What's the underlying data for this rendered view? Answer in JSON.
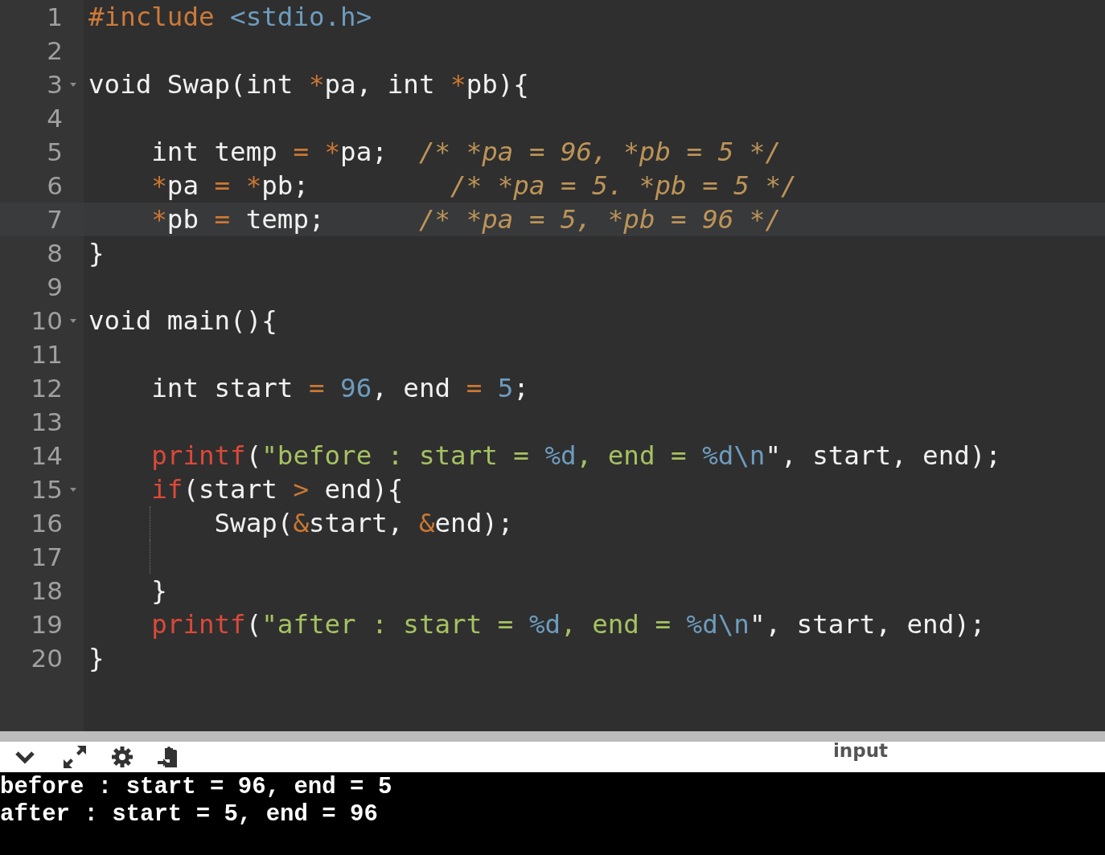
{
  "editor": {
    "lines": [
      {
        "number": "1",
        "fold": false,
        "active": false,
        "indent_guide": false,
        "tokens": [
          {
            "kind": "pre",
            "text": "#include "
          },
          {
            "kind": "header",
            "text": "<stdio.h>"
          }
        ]
      },
      {
        "number": "2",
        "fold": false,
        "active": false,
        "indent_guide": false
      },
      {
        "number": "3",
        "fold": true,
        "active": false,
        "indent_guide": false,
        "tokens": [
          {
            "kind": "plain",
            "text": "void Swap(int "
          },
          {
            "kind": "op",
            "text": "*"
          },
          {
            "kind": "plain",
            "text": "pa, int "
          },
          {
            "kind": "op",
            "text": "*"
          },
          {
            "kind": "plain",
            "text": "pb){"
          }
        ]
      },
      {
        "number": "4",
        "fold": false,
        "active": false,
        "indent_guide": false
      },
      {
        "number": "5",
        "fold": false,
        "active": false,
        "indent_guide": false,
        "tokens": [
          {
            "kind": "plain",
            "text": "    int temp "
          },
          {
            "kind": "op",
            "text": "= *"
          },
          {
            "kind": "plain",
            "text": "pa;  "
          },
          {
            "kind": "cmt",
            "text": "/* *pa = 96, *pb = 5 */"
          }
        ]
      },
      {
        "number": "6",
        "fold": false,
        "active": false,
        "indent_guide": false,
        "tokens": [
          {
            "kind": "op",
            "text": "    *"
          },
          {
            "kind": "plain",
            "text": "pa "
          },
          {
            "kind": "op",
            "text": "= *"
          },
          {
            "kind": "plain",
            "text": "pb;"
          },
          {
            "kind": "cmt",
            "text": "         /* *pa = 5. *pb = 5 */"
          }
        ]
      },
      {
        "number": "7",
        "fold": false,
        "active": true,
        "indent_guide": false,
        "tokens": [
          {
            "kind": "op",
            "text": "    *"
          },
          {
            "kind": "plain",
            "text": "pb "
          },
          {
            "kind": "op",
            "text": "="
          },
          {
            "kind": "plain",
            "text": " temp;      "
          },
          {
            "kind": "cmt",
            "text": "/* *pa = 5, *pb = 96 */"
          }
        ]
      },
      {
        "number": "8",
        "fold": false,
        "active": false,
        "indent_guide": false,
        "tokens": [
          {
            "kind": "plain",
            "text": "}"
          }
        ]
      },
      {
        "number": "9",
        "fold": false,
        "active": false,
        "indent_guide": false
      },
      {
        "number": "10",
        "fold": true,
        "active": false,
        "indent_guide": false,
        "tokens": [
          {
            "kind": "plain",
            "text": "void main(){"
          }
        ]
      },
      {
        "number": "11",
        "fold": false,
        "active": false,
        "indent_guide": false
      },
      {
        "number": "12",
        "fold": false,
        "active": false,
        "indent_guide": false,
        "tokens": [
          {
            "kind": "plain",
            "text": "    int start "
          },
          {
            "kind": "op",
            "text": "= "
          },
          {
            "kind": "num",
            "text": "96"
          },
          {
            "kind": "plain",
            "text": ", end "
          },
          {
            "kind": "op",
            "text": "= "
          },
          {
            "kind": "num",
            "text": "5"
          },
          {
            "kind": "plain",
            "text": ";"
          }
        ]
      },
      {
        "number": "13",
        "fold": false,
        "active": false,
        "indent_guide": false
      },
      {
        "number": "14",
        "fold": false,
        "active": false,
        "indent_guide": false,
        "tokens": [
          {
            "kind": "fn",
            "text": "    printf"
          },
          {
            "kind": "plain",
            "text": "("
          },
          {
            "kind": "str",
            "text": "\"before : start = "
          },
          {
            "kind": "fmt",
            "text": "%d"
          },
          {
            "kind": "str",
            "text": ", end = "
          },
          {
            "kind": "fmt",
            "text": "%d\\n"
          },
          {
            "kind": "plain",
            "text": "\", start, end);"
          }
        ]
      },
      {
        "number": "15",
        "fold": true,
        "active": false,
        "indent_guide": false,
        "tokens": [
          {
            "kind": "fn",
            "text": "    if"
          },
          {
            "kind": "plain",
            "text": "(start "
          },
          {
            "kind": "op",
            "text": ">"
          },
          {
            "kind": "plain",
            "text": " end){"
          }
        ]
      },
      {
        "number": "16",
        "fold": false,
        "active": false,
        "indent_guide": true,
        "tokens": [
          {
            "kind": "plain",
            "text": "        Swap("
          },
          {
            "kind": "op",
            "text": "&"
          },
          {
            "kind": "plain",
            "text": "start, "
          },
          {
            "kind": "op",
            "text": "&"
          },
          {
            "kind": "plain",
            "text": "end);"
          }
        ]
      },
      {
        "number": "17",
        "fold": false,
        "active": false,
        "indent_guide": true
      },
      {
        "number": "18",
        "fold": false,
        "active": false,
        "indent_guide": false,
        "tokens": [
          {
            "kind": "plain",
            "text": "    }"
          }
        ]
      },
      {
        "number": "19",
        "fold": false,
        "active": false,
        "indent_guide": false,
        "tokens": [
          {
            "kind": "fn",
            "text": "    printf"
          },
          {
            "kind": "plain",
            "text": "("
          },
          {
            "kind": "str",
            "text": "\"after : start = "
          },
          {
            "kind": "fmt",
            "text": "%d"
          },
          {
            "kind": "str",
            "text": ", end = "
          },
          {
            "kind": "fmt",
            "text": "%d\\n"
          },
          {
            "kind": "plain",
            "text": "\", start, end);"
          }
        ]
      },
      {
        "number": "20",
        "fold": false,
        "active": false,
        "indent_guide": false,
        "tokens": [
          {
            "kind": "plain",
            "text": "}"
          }
        ]
      }
    ]
  },
  "toolbar": {
    "input_label": "input"
  },
  "output": {
    "lines": [
      "before : start = 96, end = 5",
      "after : start = 5, end = 96"
    ]
  }
}
